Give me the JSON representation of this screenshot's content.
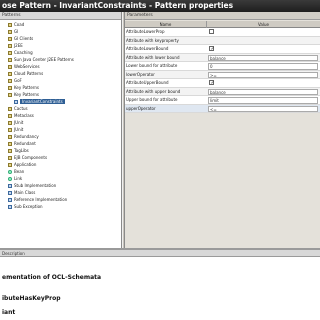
{
  "window": {
    "title": "ose Pattern - InvariantConstraints - Pattern properties"
  },
  "tree": {
    "header": "Patterns",
    "items": [
      {
        "label": "Coad",
        "icon": "folder",
        "indent": 1,
        "selected": false
      },
      {
        "label": "GI",
        "icon": "folder",
        "indent": 1,
        "selected": false
      },
      {
        "label": "GI Clients",
        "icon": "folder",
        "indent": 1,
        "selected": false
      },
      {
        "label": "J2EE",
        "icon": "folder",
        "indent": 1,
        "selected": false
      },
      {
        "label": "Coaching",
        "icon": "folder",
        "indent": 1,
        "selected": false
      },
      {
        "label": "Sun Java Center J2EE Patterns",
        "icon": "folder",
        "indent": 1,
        "selected": false
      },
      {
        "label": "WebServices",
        "icon": "folder",
        "indent": 1,
        "selected": false
      },
      {
        "label": "Cloud Patterns",
        "icon": "folder",
        "indent": 1,
        "selected": false
      },
      {
        "label": "GoF",
        "icon": "folder",
        "indent": 1,
        "selected": false
      },
      {
        "label": "Key Patterns",
        "icon": "folder",
        "indent": 1,
        "selected": false
      },
      {
        "label": "Key Patterns",
        "icon": "folder",
        "indent": 1,
        "selected": false
      },
      {
        "label": "InvariantConstraints",
        "icon": "cls",
        "indent": 2,
        "selected": true
      },
      {
        "label": "Cactus",
        "icon": "folder",
        "indent": 1,
        "selected": false
      },
      {
        "label": "Metaclass",
        "icon": "folder",
        "indent": 1,
        "selected": false
      },
      {
        "label": "JUnit",
        "icon": "folder",
        "indent": 1,
        "selected": false
      },
      {
        "label": "JUnit",
        "icon": "folder",
        "indent": 1,
        "selected": false
      },
      {
        "label": "Redundancy",
        "icon": "folder",
        "indent": 1,
        "selected": false
      },
      {
        "label": "Redundant",
        "icon": "folder",
        "indent": 1,
        "selected": false
      },
      {
        "label": "TagLibs",
        "icon": "folder",
        "indent": 1,
        "selected": false
      },
      {
        "label": "EJB Components",
        "icon": "folder",
        "indent": 1,
        "selected": false
      },
      {
        "label": "Application",
        "icon": "folder",
        "indent": 1,
        "selected": false
      },
      {
        "label": "Bean",
        "icon": "obj",
        "indent": 1,
        "selected": false
      },
      {
        "label": "Link",
        "icon": "obj",
        "indent": 1,
        "selected": false
      },
      {
        "label": "Stub Implementation",
        "icon": "cls",
        "indent": 1,
        "selected": false
      },
      {
        "label": "Main Class",
        "icon": "cls",
        "indent": 1,
        "selected": false
      },
      {
        "label": "Reference Implementation",
        "icon": "cls",
        "indent": 1,
        "selected": false
      },
      {
        "label": "Sub Exception",
        "icon": "cls",
        "indent": 1,
        "selected": false
      }
    ]
  },
  "params": {
    "header": "Parameters",
    "col_name": "Name",
    "col_value": "Value",
    "rows": [
      {
        "name": "AttributeLowerProp",
        "type": "check",
        "checked": false,
        "value": ""
      },
      {
        "name": "Attribute with keyproperty",
        "type": "text",
        "checked": false,
        "value": ""
      },
      {
        "name": "AttributeLowerBound",
        "type": "check",
        "checked": true,
        "value": ""
      },
      {
        "name": "Attribute with lower bound",
        "type": "box",
        "checked": false,
        "value": "balance"
      },
      {
        "name": "Lower bound for attribute",
        "type": "box",
        "checked": false,
        "value": "0"
      },
      {
        "name": "lowerOperator",
        "type": "box",
        "checked": false,
        "value": ">="
      },
      {
        "name": "AttributeUpperBound",
        "type": "check",
        "checked": true,
        "value": ""
      },
      {
        "name": "Attribute with upper bound",
        "type": "box",
        "checked": false,
        "value": "balance"
      },
      {
        "name": "Upper bound for attribute",
        "type": "box",
        "checked": false,
        "value": "limit"
      },
      {
        "name": "upperOperator",
        "type": "box",
        "checked": false,
        "value": "<="
      }
    ]
  },
  "bottom": {
    "header": "Description",
    "lines": [
      "ementation of OCL-Schemata",
      "ibuteHasKeyProp",
      "iant"
    ]
  }
}
